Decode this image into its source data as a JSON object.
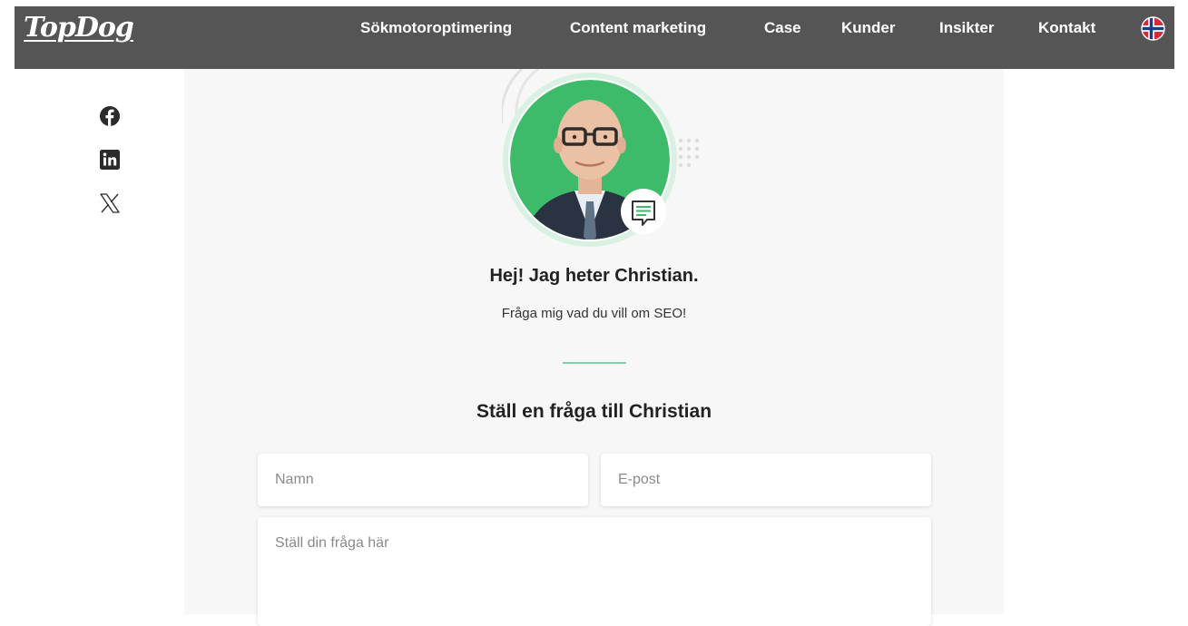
{
  "header": {
    "logo": "TopDog",
    "nav": [
      "Sökmotoroptimering",
      "Content marketing",
      "Case",
      "Kunder",
      "Insikter",
      "Kontakt"
    ],
    "language_flag_icon": "norway-flag-icon"
  },
  "social": {
    "icons": [
      "facebook-icon",
      "linkedin-icon",
      "x-icon"
    ]
  },
  "profile": {
    "greeting": "Hej! Jag heter Christian.",
    "tagline": "Fråga mig vad du vill om SEO!"
  },
  "form": {
    "heading": "Ställ en fråga till Christian",
    "name_placeholder": "Namn",
    "email_placeholder": "E-post",
    "question_placeholder": "Ställ din fråga här"
  },
  "colors": {
    "header_bg": "#555555",
    "accent_green": "#3dbb6a",
    "panel_bg": "#f7f7f7"
  }
}
